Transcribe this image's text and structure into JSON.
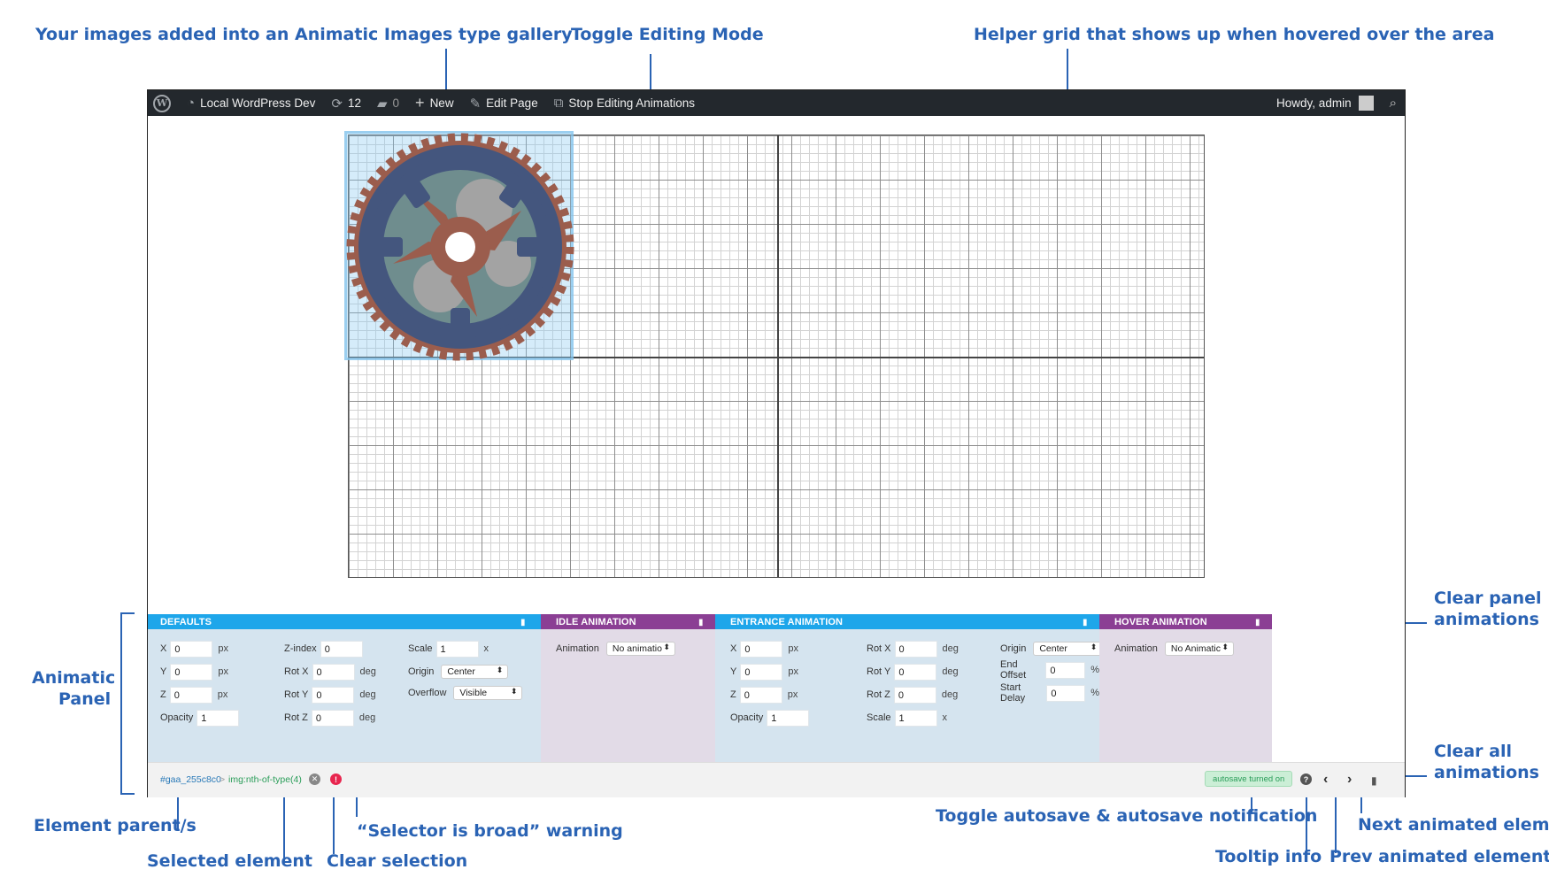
{
  "annotations": {
    "gallery": "Your images added into an Animatic Images type gallery",
    "toggle_editing": "Toggle Editing Mode",
    "helper_grid": "Helper grid that shows up when hovered over the area",
    "clear_panel_1": "Clear panel",
    "clear_panel_2": "animations",
    "animatic_panel_1": "Animatic",
    "animatic_panel_2": "Panel",
    "clear_all_1": "Clear all",
    "clear_all_2": "animations",
    "element_parent": "Element parent/s",
    "selected_element": "Selected element",
    "clear_selection": "Clear selection",
    "selector_warning": "“Selector is broad” warning",
    "toggle_autosave": "Toggle autosave & autosave notification",
    "tooltip_info": "Tooltip info",
    "prev_element": "Prev animated element",
    "next_element": "Next animated element"
  },
  "adminbar": {
    "site_name": "Local WordPress Dev",
    "updates_count": "12",
    "comments_count": "0",
    "new_label": "New",
    "edit_page": "Edit Page",
    "stop_editing": "Stop Editing Animations",
    "howdy": "Howdy, admin"
  },
  "panel": {
    "defaults": {
      "title": "DEFAULTS",
      "x": "0",
      "y": "0",
      "z": "0",
      "opacity": "1",
      "zindex": "0",
      "rotx": "0",
      "roty": "0",
      "rotz": "0",
      "scale": "1",
      "origin": "Center",
      "overflow": "Visible"
    },
    "idle": {
      "title": "IDLE ANIMATION",
      "animation": "No animatio"
    },
    "entrance": {
      "title": "ENTRANCE ANIMATION",
      "x": "0",
      "y": "0",
      "z": "0",
      "opacity": "1",
      "rotx": "0",
      "roty": "0",
      "rotz": "0",
      "scale": "1",
      "origin": "Center",
      "end_offset": "0",
      "start_delay": "0"
    },
    "hover": {
      "title": "HOVER ANIMATION",
      "animation": "No Animatic"
    },
    "labels": {
      "x": "X",
      "y": "Y",
      "z": "Z",
      "opacity": "Opacity",
      "zindex": "Z-index",
      "rotx": "Rot X",
      "roty": "Rot Y",
      "rotz": "Rot Z",
      "scale": "Scale",
      "origin": "Origin",
      "overflow": "Overflow",
      "animation": "Animation",
      "end_offset": "End Offset",
      "start_delay": "Start Delay",
      "px": "px",
      "deg": "deg",
      "x_unit": "x",
      "pct": "%"
    },
    "footer": {
      "parent": "#gaa_255c8c0",
      "separator": ">",
      "selected": "img:nth-of-type(4)",
      "autosave": "autosave turned on"
    }
  },
  "colors": {
    "annotation": "#2a63b4",
    "adminbar": "#23282d",
    "section_blue": "#1ea6ea",
    "section_purple": "#8b3f94"
  }
}
